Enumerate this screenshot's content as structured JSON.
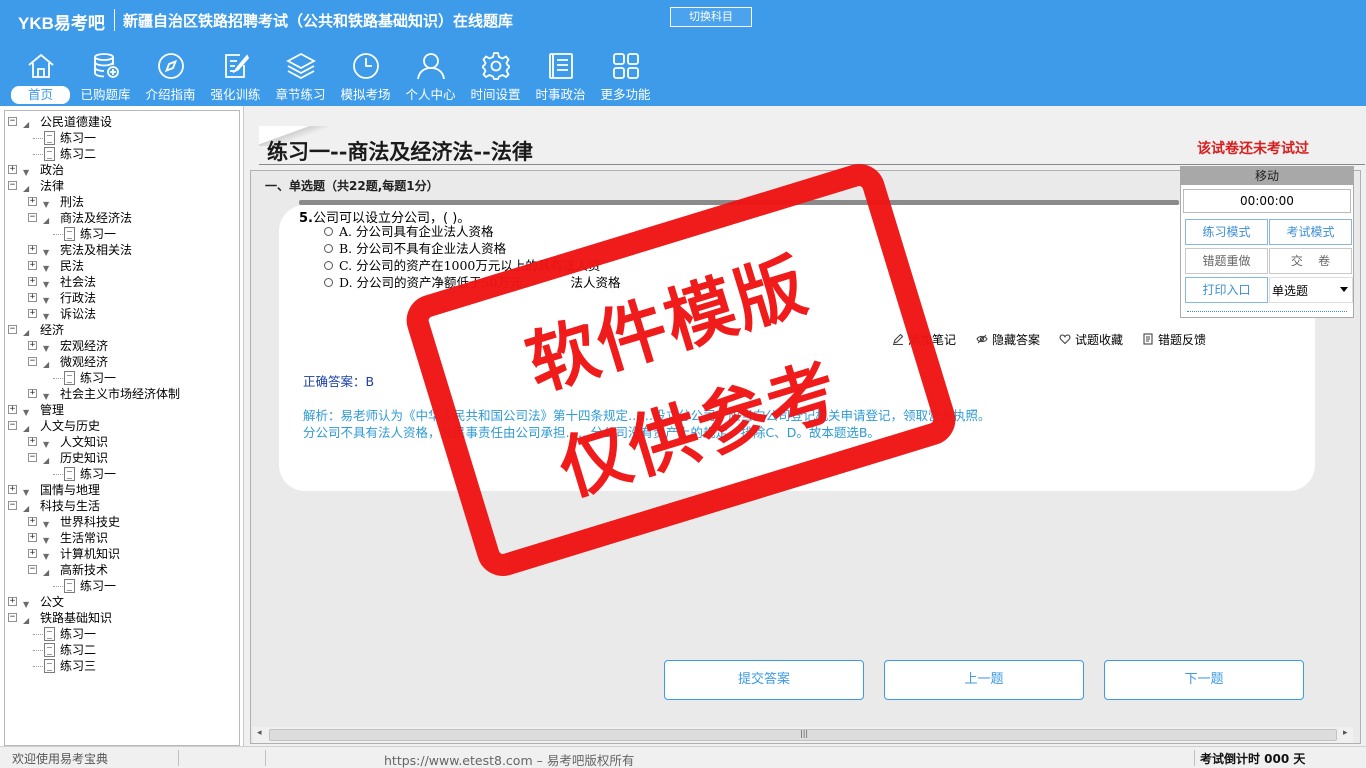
{
  "header": {
    "logo": "YKB易考吧",
    "title": "新疆自治区铁路招聘考试（公共和铁路基础知识）在线题库",
    "switch_label": "切换科目"
  },
  "nav": [
    {
      "label": "首页",
      "icon": "home-icon"
    },
    {
      "label": "已购题库",
      "icon": "database-icon"
    },
    {
      "label": "介绍指南",
      "icon": "compass-icon"
    },
    {
      "label": "强化训练",
      "icon": "edit-icon"
    },
    {
      "label": "章节练习",
      "icon": "layers-icon"
    },
    {
      "label": "模拟考场",
      "icon": "clock-icon"
    },
    {
      "label": "个人中心",
      "icon": "user-icon"
    },
    {
      "label": "时间设置",
      "icon": "gear-icon"
    },
    {
      "label": "时事政治",
      "icon": "news-icon"
    },
    {
      "label": "更多功能",
      "icon": "grid-icon"
    }
  ],
  "tree": [
    {
      "label": "公民道德建设",
      "level": 0,
      "kind": "open"
    },
    {
      "label": "练习一",
      "level": 1,
      "kind": "doc"
    },
    {
      "label": "练习二",
      "level": 1,
      "kind": "doc"
    },
    {
      "label": "政治",
      "level": 0,
      "kind": "closed"
    },
    {
      "label": "法律",
      "level": 0,
      "kind": "open"
    },
    {
      "label": "刑法",
      "level": 1,
      "kind": "closed"
    },
    {
      "label": "商法及经济法",
      "level": 1,
      "kind": "open"
    },
    {
      "label": "练习一",
      "level": 2,
      "kind": "doc"
    },
    {
      "label": "宪法及相关法",
      "level": 1,
      "kind": "closed"
    },
    {
      "label": "民法",
      "level": 1,
      "kind": "closed"
    },
    {
      "label": "社会法",
      "level": 1,
      "kind": "closed"
    },
    {
      "label": "行政法",
      "level": 1,
      "kind": "closed"
    },
    {
      "label": "诉讼法",
      "level": 1,
      "kind": "closed"
    },
    {
      "label": "经济",
      "level": 0,
      "kind": "open"
    },
    {
      "label": "宏观经济",
      "level": 1,
      "kind": "closed"
    },
    {
      "label": "微观经济",
      "level": 1,
      "kind": "open"
    },
    {
      "label": "练习一",
      "level": 2,
      "kind": "doc"
    },
    {
      "label": "社会主义市场经济体制",
      "level": 1,
      "kind": "closed"
    },
    {
      "label": "管理",
      "level": 0,
      "kind": "closed"
    },
    {
      "label": "人文与历史",
      "level": 0,
      "kind": "open"
    },
    {
      "label": "人文知识",
      "level": 1,
      "kind": "closed"
    },
    {
      "label": "历史知识",
      "level": 1,
      "kind": "open"
    },
    {
      "label": "练习一",
      "level": 2,
      "kind": "doc"
    },
    {
      "label": "国情与地理",
      "level": 0,
      "kind": "closed"
    },
    {
      "label": "科技与生活",
      "level": 0,
      "kind": "open"
    },
    {
      "label": "世界科技史",
      "level": 1,
      "kind": "closed"
    },
    {
      "label": "生活常识",
      "level": 1,
      "kind": "closed"
    },
    {
      "label": "计算机知识",
      "level": 1,
      "kind": "closed"
    },
    {
      "label": "高新技术",
      "level": 1,
      "kind": "open"
    },
    {
      "label": "练习一",
      "level": 2,
      "kind": "doc"
    },
    {
      "label": "公文",
      "level": 0,
      "kind": "closed"
    },
    {
      "label": "铁路基础知识",
      "level": 0,
      "kind": "open"
    },
    {
      "label": "练习一",
      "level": 1,
      "kind": "doc"
    },
    {
      "label": "练习二",
      "level": 1,
      "kind": "doc"
    },
    {
      "label": "练习三",
      "level": 1,
      "kind": "doc"
    }
  ],
  "main": {
    "paper_title": "练习一--商法及经济法--法律",
    "status": "该试卷还未考试过",
    "section_title": "一、单选题（共22题,每题1分）",
    "question": {
      "number": "5.",
      "stem": "公司可以设立分公司，( )。",
      "options": [
        "A. 分公司具有企业法人资格",
        "B. 分公司不具有企业法人资格",
        "C. 分公司的资产在1000万元以上的具有法人资",
        "D. 分公司的资产净额低于50万元"
      ],
      "option_d_tail": "法人资格",
      "actions": [
        "添加笔记",
        "隐藏答案",
        "试题收藏",
        "错题反馈"
      ],
      "answer_label": "正确答案：",
      "answer": "B",
      "analysis_line1": "解析：易老师认为《中华人民共和国公司法》第十四条规定……设立分公司，应当向公司登记机关申请登记，领取营业执照。",
      "analysis_line2": "分公司不具有法人资格，其民事责任由公司承担……分公司没有资产上的规定，排除C、D。故本题选B。"
    },
    "buttons": {
      "submit": "提交答案",
      "prev": "上一题",
      "next": "下一题"
    }
  },
  "mode_panel": {
    "move_label": "移动",
    "timer": "00:00:00",
    "practice_mode": "练习模式",
    "exam_mode": "考试模式",
    "redo_wrong": "错题重做",
    "submit_paper": "交    卷",
    "print": "打印入口",
    "question_type": "单选题"
  },
  "status_bar": {
    "welcome": "欢迎使用易考宝典",
    "copyright": "https://www.etest8.com – 易考吧版权所有",
    "countdown_label": "考试倒计时 000 天"
  },
  "watermark": {
    "line1": "软件模版",
    "line2": "仅供参考"
  }
}
